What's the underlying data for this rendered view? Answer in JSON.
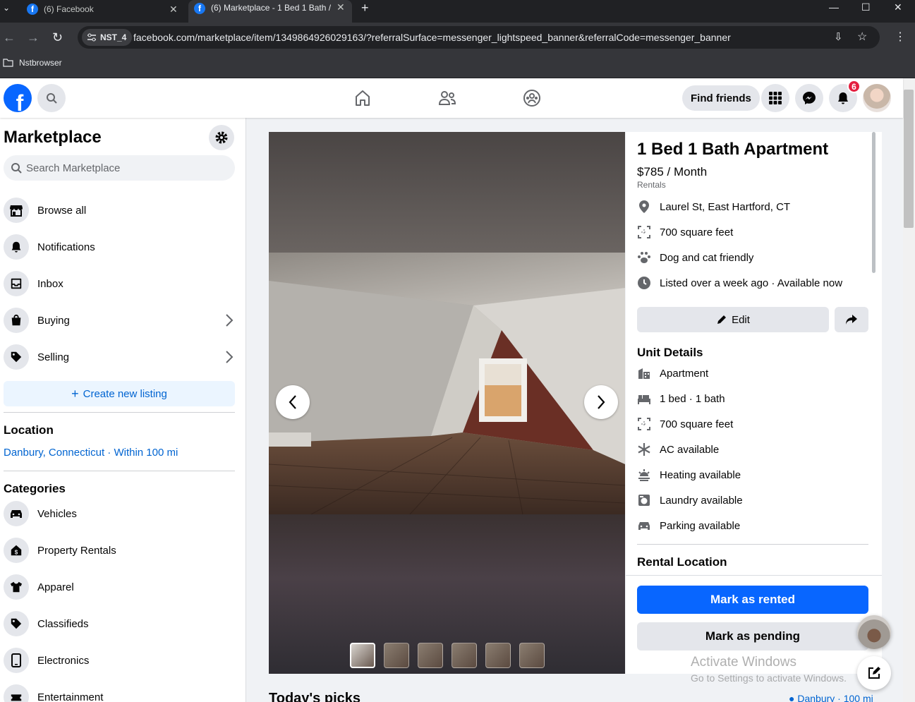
{
  "browser": {
    "tabs": [
      {
        "title": "(6) Facebook"
      },
      {
        "title": "(6) Marketplace - 1 Bed 1 Bath /"
      }
    ],
    "profile_chip": "NST_4",
    "url": "facebook.com/marketplace/item/1349864926029163/?referralSurface=messenger_lightspeed_banner&referralCode=messenger_banner",
    "bookmark": "Nstbrowser"
  },
  "header": {
    "find_friends": "Find friends",
    "notification_count": "6",
    "brand_color": "#0866ff"
  },
  "sidebar": {
    "title": "Marketplace",
    "search_placeholder": "Search Marketplace",
    "nav": [
      {
        "label": "Browse all",
        "icon": "storefront-icon"
      },
      {
        "label": "Notifications",
        "icon": "bell-icon"
      },
      {
        "label": "Inbox",
        "icon": "inbox-icon"
      },
      {
        "label": "Buying",
        "icon": "bag-icon"
      },
      {
        "label": "Selling",
        "icon": "tag-icon"
      }
    ],
    "create_listing": "Create new listing",
    "location_title": "Location",
    "location_value": "Danbury, Connecticut · Within 100 mi",
    "categories_title": "Categories",
    "categories": [
      {
        "label": "Vehicles",
        "icon": "car-icon"
      },
      {
        "label": "Property Rentals",
        "icon": "house-dollar-icon"
      },
      {
        "label": "Apparel",
        "icon": "shirt-icon"
      },
      {
        "label": "Classifieds",
        "icon": "tag-icon"
      },
      {
        "label": "Electronics",
        "icon": "phone-icon"
      },
      {
        "label": "Entertainment",
        "icon": "ticket-icon"
      }
    ]
  },
  "listing": {
    "title": "1 Bed 1 Bath Apartment",
    "price": "$785 / Month",
    "category": "Rentals",
    "info": [
      {
        "text": "Laurel St, East Hartford, CT",
        "icon": "location-pin-icon"
      },
      {
        "text": "700 square feet",
        "icon": "area-icon"
      },
      {
        "text": "Dog and cat friendly",
        "icon": "paw-icon"
      },
      {
        "text": "Listed over a week ago · Available now",
        "icon": "clock-icon"
      }
    ],
    "edit": "Edit",
    "unit_details_title": "Unit Details",
    "unit_details": [
      {
        "text": "Apartment",
        "icon": "building-icon"
      },
      {
        "text": "1 bed · 1 bath",
        "icon": "bed-icon"
      },
      {
        "text": "700 square feet",
        "icon": "area-icon"
      },
      {
        "text": "AC available",
        "icon": "snowflake-icon"
      },
      {
        "text": "Heating available",
        "icon": "heat-icon"
      },
      {
        "text": "Laundry available",
        "icon": "washer-icon"
      },
      {
        "text": "Parking available",
        "icon": "car-icon"
      }
    ],
    "rental_location_title": "Rental Location",
    "mark_rented": "Mark as rented",
    "mark_pending": "Mark as pending",
    "photo_count": 6
  },
  "feed": {
    "todays_picks": "Today's picks",
    "location": "Danbury · 100 mi"
  },
  "watermark": {
    "line1": "Activate Windows",
    "line2": "Go to Settings to activate Windows."
  }
}
